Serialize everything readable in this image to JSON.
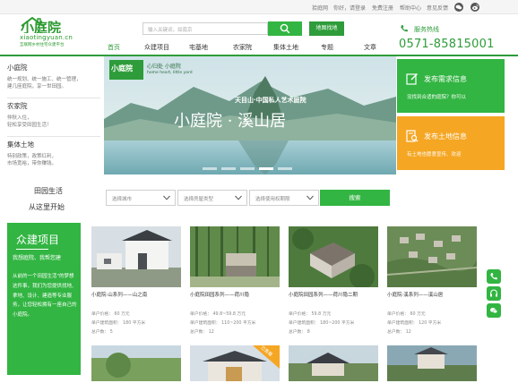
{
  "topbar": {
    "links": [
      "拾庭网",
      "你好，请登录",
      "免费注册",
      "帮助中心",
      "意见反馈"
    ]
  },
  "logo": {
    "mark": "小庭院",
    "pinyin": "xiaotingyuan.cn",
    "slogan": "互联网乡村住宅众建平台"
  },
  "search": {
    "placeholder": "输入关键词，如南京",
    "find_land_label": "地图找地"
  },
  "hotline": {
    "label": "服务热线",
    "number": "0571-85815001"
  },
  "nav": {
    "items": [
      "首页",
      "众建项目",
      "宅基地",
      "农家院",
      "集体土地",
      "专题",
      "文章"
    ]
  },
  "categories": [
    {
      "title": "小庭院",
      "lines": [
        "统一规划、统一施工、统一管理，",
        "建几座庭院，享一世田园。"
      ]
    },
    {
      "title": "农家院",
      "lines": [
        "仲秋入住，",
        "轻松享受田园生活！"
      ]
    },
    {
      "title": "集体土地",
      "lines": [
        "特别政策，政策红利，",
        "市场宽裕，带你赚钱。"
      ]
    }
  ],
  "banner": {
    "logo_text": "小庭院",
    "logo_tagline_a": "心归处  小庭院",
    "logo_tagline_b": "home heart,  little yard",
    "subtitle": "天目山·中国私人艺术庭院",
    "title": "小庭院 · 溪山居"
  },
  "promos": [
    {
      "title": "发布需求信息",
      "sub": "没找到合适的庭院？你可以",
      "color": "#32b542"
    },
    {
      "title": "发布土地信息",
      "sub": "有土地也愿意宣传、欢迎",
      "color": "#f5a623"
    }
  ],
  "filter": {
    "tab_country": "田园生活",
    "tab_start": "从这里开始",
    "selects": [
      "选择城市",
      "选择房屋类型",
      "选择使用权期限"
    ],
    "search_label": "搜索"
  },
  "crowd": {
    "title": "众建项目",
    "slogan": "我想庭院、我帮您建",
    "desc": "从前的一个田园生活\"的梦想这件事，我们为您提供找地、拿地、设计、建造等专业服务，让您轻松拥有一座自己的小庭院。"
  },
  "cards": [
    {
      "name": "小庭院·山系列——山之南",
      "price": "单户价格：  60 万元",
      "area": "单户建筑面积：  180 平方米",
      "households": "总户数：  5"
    },
    {
      "name": "小庭院田园系列——荷川隐",
      "price": "单户价格：  49.8~59.8 万元",
      "area": "单户建筑面积：  110~200 平方米",
      "households": "总户数：  12"
    },
    {
      "name": "小庭院田园系列——荷川隐二期",
      "price": "单户价格：  59.8 万元",
      "area": "单户建筑面积：  180~200 平方米",
      "households": "总户数：  8"
    },
    {
      "name": "小庭院·溪系列——溪山居",
      "price": "单户价格：  60 万元",
      "area": "单户建筑面积：  120 平方米",
      "households": "总户数：  12"
    }
  ],
  "badge": {
    "label": "已售罄"
  },
  "colors": {
    "brand_green": "#32b542",
    "dark_green": "#2e9c3a",
    "orange": "#f5a623"
  }
}
